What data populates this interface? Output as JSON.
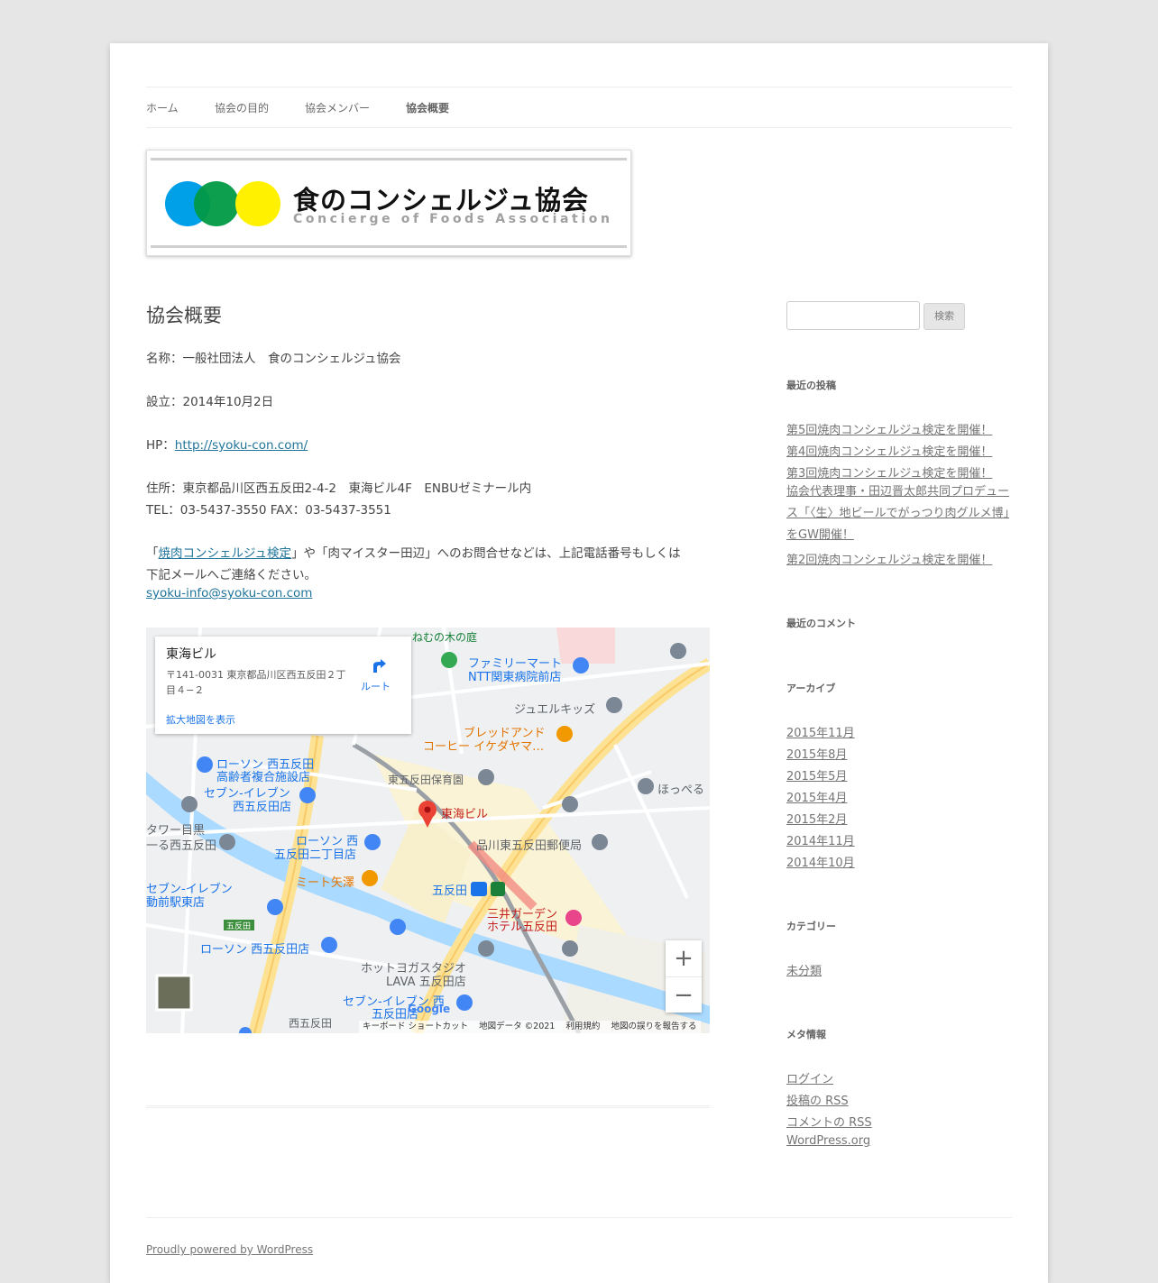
{
  "nav": {
    "items": [
      {
        "label": "ホーム"
      },
      {
        "label": "協会の目的"
      },
      {
        "label": "協会メンバー"
      },
      {
        "label": "協会概要"
      }
    ]
  },
  "logo": {
    "title": "食のコンシェルジュ協会",
    "subtitle": "Concierge of Foods Association",
    "colors": [
      "#00a0e9",
      "#009944",
      "#fff100"
    ]
  },
  "entry": {
    "title": "協会概要",
    "name_line": "名称：一般社団法人　食のコンシェルジュ協会",
    "established_line": "設立：2014年10月2日",
    "hp_prefix": "HP：",
    "hp_link": "http://syoku-con.com/",
    "address_line": "住所：東京都品川区西五反田2-4-2　東海ビル4F　ENBUゼミナール内",
    "tel_line": "TEL：03-5437-3550  FAX：03-5437-3551",
    "inquiry_open": "「",
    "inquiry_link": "焼肉コンシェルジュ検定",
    "inquiry_rest": "」や「肉マイスター田辺」へのお問合せなどは、上記電話番号もしくは",
    "inquiry_line2": "下記メールへご連絡ください。",
    "email": "syoku-info@syoku-con.com"
  },
  "map": {
    "card_name": "東海ビル",
    "card_address": "〒141-0031 東京都品川区西五反田２丁目４−２",
    "card_route": "ルート",
    "card_larger": "拡大地図を表示",
    "marker_label": "東海ビル",
    "labels": [
      "ねむの木の庭",
      "ファミリーマート",
      "NTT関東病院前店",
      "ジュエルキッズ",
      "ブレッドアンド",
      "コーヒー イケダヤマ…",
      "ローソン 西五反田",
      "高齢者複合施設店",
      "セブン-イレブン",
      "西五反田店",
      "東五反田保育園",
      "ほっぺる",
      "ローソン 西",
      "五反田二丁目店",
      "品川東五反田郵便局",
      "ミート矢澤",
      "五反田",
      "三井ガーデン",
      "ホテル五反田",
      "ローソン 西五反田店",
      "ホットヨガスタジオ",
      "LAVA 五反田店",
      "セブン-イレブン 西",
      "五反田店",
      "西五反田",
      "セブン-イレブン",
      "動前駅東店",
      "タワー目黒",
      "一る西五反田"
    ],
    "zoom_in": "+",
    "zoom_out": "−",
    "footer_keyboard": "キーボード ショートカット",
    "footer_data": "地図データ ©2021",
    "footer_terms": "利用規約",
    "footer_report": "地図の誤りを報告する",
    "google": "Google"
  },
  "sidebar": {
    "search_button": "検索",
    "recent_posts_title": "最近の投稿",
    "recent_posts": [
      "第5回焼肉コンシェルジュ検定を開催！",
      "第4回焼肉コンシェルジュ検定を開催！",
      "第3回焼肉コンシェルジュ検定を開催！",
      "協会代表理事・田辺晋太郎共同プロデュース「〈生〉地ビールでがっつり肉グルメ博」をGW開催！",
      "第2回焼肉コンシェルジュ検定を開催！"
    ],
    "recent_comments_title": "最近のコメント",
    "archives_title": "アーカイブ",
    "archives": [
      "2015年11月",
      "2015年8月",
      "2015年5月",
      "2015年4月",
      "2015年2月",
      "2014年11月",
      "2014年10月"
    ],
    "categories_title": "カテゴリー",
    "categories": [
      "未分類"
    ],
    "meta_title": "メタ情報",
    "meta": [
      "ログイン",
      "投稿の RSS",
      "コメントの RSS",
      "WordPress.org"
    ]
  },
  "footer": {
    "powered": "Proudly powered by WordPress"
  }
}
